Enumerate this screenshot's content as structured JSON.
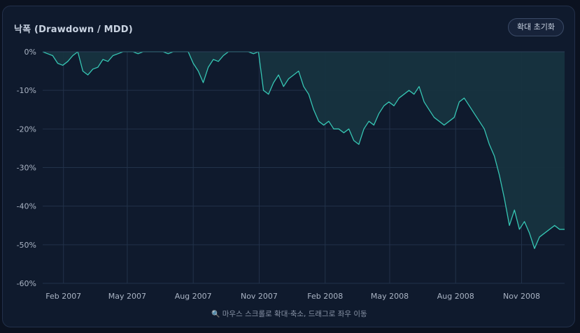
{
  "header": {
    "title": "낙폭 (Drawdown / MDD)",
    "reset_button": "확대 초기화"
  },
  "footer": {
    "hint_icon": "magnifier-icon",
    "hint": "마우스 스크롤로 확대·축소, 드래그로 좌우 이동"
  },
  "colors": {
    "background": "#0b1220",
    "panel": "#0f1a2d",
    "line": "#36c6b4",
    "area": "#17333f",
    "grid": "#22324a"
  },
  "chart_data": {
    "type": "area",
    "ylabel": "",
    "xlabel": "",
    "ylim": [
      -60,
      0
    ],
    "y_ticks": [
      "0%",
      "-10%",
      "-20%",
      "-30%",
      "-40%",
      "-50%",
      "-60%"
    ],
    "x_ticks": [
      "Feb 2007",
      "May 2007",
      "Aug 2007",
      "Nov 2007",
      "Feb 2008",
      "May 2008",
      "Aug 2008",
      "Nov 2008"
    ],
    "grid": true,
    "series": [
      {
        "x": [
          "2007-01-03",
          "2007-01-10",
          "2007-01-17",
          "2007-01-24",
          "2007-01-31",
          "2007-02-07",
          "2007-02-14",
          "2007-02-21",
          "2007-02-28",
          "2007-03-07",
          "2007-03-14",
          "2007-03-21",
          "2007-03-28",
          "2007-04-04",
          "2007-04-11",
          "2007-04-18",
          "2007-04-25",
          "2007-05-02",
          "2007-05-09",
          "2007-05-16",
          "2007-05-23",
          "2007-05-30",
          "2007-06-06",
          "2007-06-13",
          "2007-06-20",
          "2007-06-27",
          "2007-07-04",
          "2007-07-11",
          "2007-07-18",
          "2007-07-25",
          "2007-08-01",
          "2007-08-08",
          "2007-08-15",
          "2007-08-22",
          "2007-08-29",
          "2007-09-05",
          "2007-09-12",
          "2007-09-19",
          "2007-09-26",
          "2007-10-03",
          "2007-10-10",
          "2007-10-17",
          "2007-10-24",
          "2007-10-31",
          "2007-11-07",
          "2007-11-14",
          "2007-11-21",
          "2007-11-28",
          "2007-12-05",
          "2007-12-12",
          "2007-12-19",
          "2007-12-26",
          "2008-01-02",
          "2008-01-09",
          "2008-01-16",
          "2008-01-23",
          "2008-01-30",
          "2008-02-06",
          "2008-02-13",
          "2008-02-20",
          "2008-02-27",
          "2008-03-05",
          "2008-03-12",
          "2008-03-19",
          "2008-03-26",
          "2008-04-02",
          "2008-04-09",
          "2008-04-16",
          "2008-04-23",
          "2008-04-30",
          "2008-05-07",
          "2008-05-14",
          "2008-05-21",
          "2008-05-28",
          "2008-06-04",
          "2008-06-11",
          "2008-06-18",
          "2008-06-25",
          "2008-07-02",
          "2008-07-09",
          "2008-07-16",
          "2008-07-23",
          "2008-07-30",
          "2008-08-06",
          "2008-08-13",
          "2008-08-20",
          "2008-08-27",
          "2008-09-03",
          "2008-09-10",
          "2008-09-17",
          "2008-09-24",
          "2008-10-01",
          "2008-10-08",
          "2008-10-15",
          "2008-10-22",
          "2008-10-29",
          "2008-11-05",
          "2008-11-12",
          "2008-11-19",
          "2008-11-26",
          "2008-12-03",
          "2008-12-10",
          "2008-12-17",
          "2008-12-24",
          "2008-12-31"
        ],
        "y": [
          0,
          -0.5,
          -1,
          -3,
          -3.5,
          -2.5,
          -1,
          0,
          -5,
          -6,
          -4.5,
          -4,
          -2,
          -2.5,
          -1,
          -0.5,
          0,
          0,
          0,
          -0.5,
          0,
          0,
          0,
          0,
          0,
          -0.5,
          0,
          0,
          0,
          0,
          -3,
          -5,
          -8,
          -4,
          -2,
          -2.5,
          -1,
          0,
          0,
          0,
          0,
          0,
          -0.5,
          0,
          -10,
          -11,
          -8,
          -6,
          -9,
          -7,
          -6,
          -5,
          -9,
          -11,
          -15,
          -18,
          -19,
          -18,
          -20,
          -20,
          -21,
          -20,
          -23,
          -24,
          -20,
          -18,
          -19,
          -16,
          -14,
          -13,
          -14,
          -12,
          -11,
          -10,
          -11,
          -9,
          -13,
          -15,
          -17,
          -18,
          -19,
          -18,
          -17,
          -13,
          -12,
          -14,
          -16,
          -18,
          -20,
          -24,
          -27,
          -32,
          -38,
          -45,
          -41,
          -46,
          -44,
          -47,
          -51,
          -48,
          -47,
          -46,
          -45,
          -46,
          -46
        ]
      }
    ]
  }
}
